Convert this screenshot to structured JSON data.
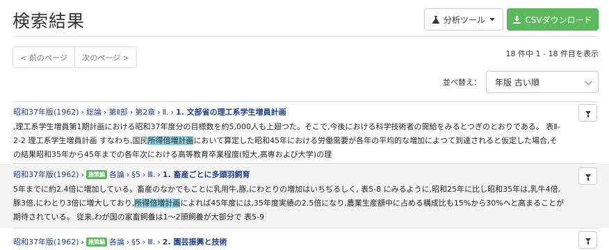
{
  "page": {
    "title": "検索結果"
  },
  "toolbar": {
    "analysis_label": "分析ツール",
    "csv_label": "CSVダウンロード"
  },
  "pager": {
    "prev_label": "< 前のページ",
    "next_label": "次のページ >",
    "count_text": "18 件中 1 - 18 件目を表示"
  },
  "sort": {
    "label": "並べ替え：",
    "value": "年版 古い順"
  },
  "results": [
    {
      "crumbs": [
        "昭和37年版(1962)",
        "総論",
        "第Ⅱ部",
        "第2章",
        "Ⅱ."
      ],
      "badge": "",
      "title": "1. 文部省の理工系学生増員計画",
      "lines": [
        ",理工系学生増員第1期計画における昭和37年度分の目標数を約5,000人も上廻つた。そこで,今後における科学技術者の需給をみるとつぎのとおりである。 表Ⅱ-",
        "2-2 理工系学生増員計画 すなわち,国民",
        "所得倍増計画",
        "において算定した昭和45年における労働需要が各年の平均的な増加によつて到達されると仮定した場合,そ",
        "の結果昭和35年から45年までの各年次における高等教育卒業程度(短大,高専および大学)の理"
      ]
    },
    {
      "crumbs": [
        "昭和37年版(1962)",
        "各論",
        "§5",
        "Ⅲ."
      ],
      "badge": "施策編",
      "title": "1. 畜産ごとに多頭羽飼育",
      "lines": [
        "5年までに約2.4倍に増加している。畜産のなかでもことに乳用牛,豚,にわとりの増加はいちぢるしく, 表5-8 にみるように,昭和25年に比し昭和35年は,乳牛4倍,",
        "豚3倍,にわとり3倍に増大しており,",
        "所得倍増計画",
        "によれば45年度には,35年度実績の2.5倍になり,農業生産額中に占める構成比も15%から30%へと高まることが",
        "期待されている。 従来,わが国の家畜飼養は1～2頭飼養が大部分で 表5-9"
      ]
    },
    {
      "crumbs": [
        "昭和37年版(1962)",
        "各論",
        "§5",
        "Ⅲ."
      ],
      "badge": "施策編",
      "title": "2. 園芸振興と技術"
    }
  ]
}
